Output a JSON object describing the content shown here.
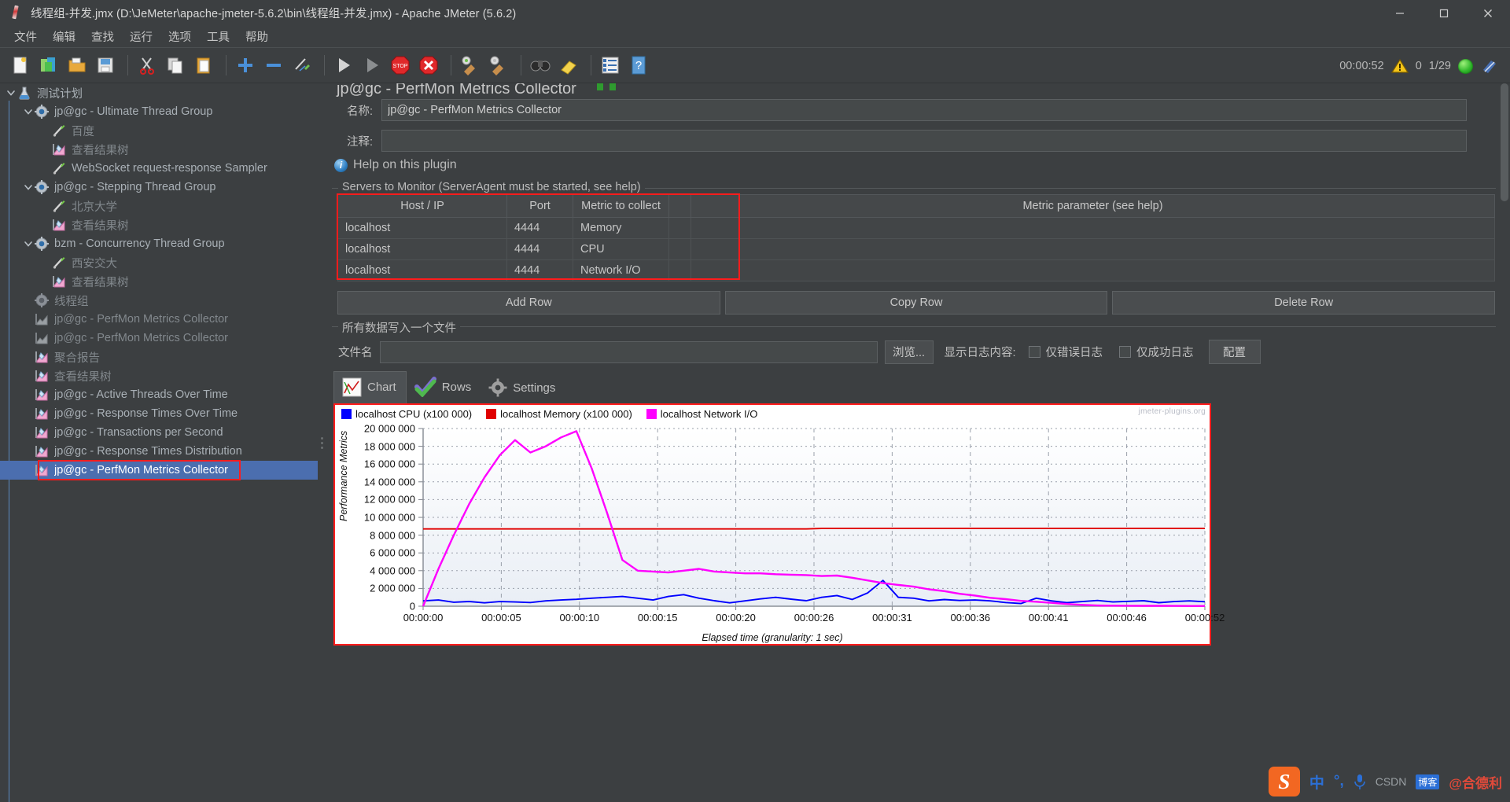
{
  "window": {
    "title": "线程组-并发.jmx (D:\\JeMeter\\apache-jmeter-5.6.2\\bin\\线程组-并发.jmx) - Apache JMeter (5.6.2)",
    "minimize_label": "Minimize",
    "maximize_label": "Maximize",
    "close_label": "Close"
  },
  "menubar": {
    "items": [
      {
        "label": "文件"
      },
      {
        "label": "编辑"
      },
      {
        "label": "查找"
      },
      {
        "label": "运行"
      },
      {
        "label": "选项"
      },
      {
        "label": "工具"
      },
      {
        "label": "帮助"
      }
    ]
  },
  "toolbar": {
    "buttons": [
      {
        "name": "new-test-plan",
        "icon": "new-document-icon"
      },
      {
        "name": "templates",
        "icon": "templates-icon"
      },
      {
        "name": "open",
        "icon": "open-folder-icon"
      },
      {
        "name": "save",
        "icon": "save-disk-icon"
      },
      {
        "name": "cut",
        "icon": "scissors-icon"
      },
      {
        "name": "copy",
        "icon": "copy-icon"
      },
      {
        "name": "paste",
        "icon": "clipboard-icon"
      },
      {
        "name": "expand-all",
        "icon": "plus-icon"
      },
      {
        "name": "collapse-all",
        "icon": "minus-icon"
      },
      {
        "name": "toggle",
        "icon": "toggle-pencil-icon"
      },
      {
        "name": "start",
        "icon": "play-icon"
      },
      {
        "name": "start-no-pauses",
        "icon": "play-no-pause-icon"
      },
      {
        "name": "stop",
        "icon": "stop-sign-icon"
      },
      {
        "name": "shutdown",
        "icon": "shutdown-icon"
      },
      {
        "name": "clear",
        "icon": "broom-green-icon"
      },
      {
        "name": "clear-all",
        "icon": "broom-icon"
      },
      {
        "name": "search",
        "icon": "binoculars-icon"
      },
      {
        "name": "reset-search",
        "icon": "eraser-icon"
      },
      {
        "name": "function-helper",
        "icon": "list-icon"
      },
      {
        "name": "help",
        "icon": "question-help-icon"
      }
    ],
    "elapsed_time": "00:00:52",
    "warning_count": "0",
    "threads_count": "1/29",
    "status_icon": "green-orb-icon",
    "jmeter_logo": "jmeter-feather-icon"
  },
  "tree": {
    "items": [
      {
        "label": "测试计划",
        "depth": 0,
        "icon": "test-plan-icon",
        "twisty": "expanded",
        "dim": false,
        "selected": false
      },
      {
        "label": "jp@gc - Ultimate Thread Group",
        "depth": 1,
        "icon": "thread-group-icon",
        "twisty": "expanded",
        "dim": false,
        "selected": false
      },
      {
        "label": "百度",
        "depth": 2,
        "icon": "sampler-icon",
        "twisty": "none",
        "dim": true,
        "selected": false
      },
      {
        "label": "查看结果树",
        "depth": 2,
        "icon": "listener-icon",
        "twisty": "none",
        "dim": true,
        "selected": false
      },
      {
        "label": "WebSocket request-response Sampler",
        "depth": 2,
        "icon": "sampler-icon",
        "twisty": "none",
        "dim": false,
        "selected": false
      },
      {
        "label": "jp@gc - Stepping Thread Group",
        "depth": 1,
        "icon": "thread-group-icon",
        "twisty": "expanded",
        "dim": false,
        "selected": false
      },
      {
        "label": "北京大学",
        "depth": 2,
        "icon": "sampler-icon",
        "twisty": "none",
        "dim": true,
        "selected": false
      },
      {
        "label": "查看结果树",
        "depth": 2,
        "icon": "listener-icon",
        "twisty": "none",
        "dim": true,
        "selected": false
      },
      {
        "label": "bzm - Concurrency Thread Group",
        "depth": 1,
        "icon": "thread-group-icon",
        "twisty": "expanded",
        "dim": false,
        "selected": false
      },
      {
        "label": "西安交大",
        "depth": 2,
        "icon": "sampler-icon",
        "twisty": "none",
        "dim": true,
        "selected": false
      },
      {
        "label": "查看结果树",
        "depth": 2,
        "icon": "listener-icon",
        "twisty": "none",
        "dim": true,
        "selected": false
      },
      {
        "label": "线程组",
        "depth": 1,
        "icon": "thread-group-disabled-icon",
        "twisty": "none",
        "dim": true,
        "selected": false
      },
      {
        "label": "jp@gc - PerfMon Metrics Collector",
        "depth": 1,
        "icon": "listener-disabled-icon",
        "twisty": "none",
        "dim": true,
        "selected": false
      },
      {
        "label": "jp@gc - PerfMon Metrics Collector",
        "depth": 1,
        "icon": "listener-disabled-icon",
        "twisty": "none",
        "dim": true,
        "selected": false
      },
      {
        "label": "聚合报告",
        "depth": 1,
        "icon": "listener-icon",
        "twisty": "none",
        "dim": true,
        "selected": false
      },
      {
        "label": "查看结果树",
        "depth": 1,
        "icon": "listener-icon",
        "twisty": "none",
        "dim": true,
        "selected": false
      },
      {
        "label": "jp@gc - Active Threads Over Time",
        "depth": 1,
        "icon": "listener-icon",
        "twisty": "none",
        "dim": false,
        "selected": false
      },
      {
        "label": "jp@gc - Response Times Over Time",
        "depth": 1,
        "icon": "listener-icon",
        "twisty": "none",
        "dim": false,
        "selected": false
      },
      {
        "label": "jp@gc - Transactions per Second",
        "depth": 1,
        "icon": "listener-icon",
        "twisty": "none",
        "dim": false,
        "selected": false
      },
      {
        "label": "jp@gc - Response Times Distribution",
        "depth": 1,
        "icon": "listener-icon",
        "twisty": "none",
        "dim": false,
        "selected": false
      },
      {
        "label": "jp@gc - PerfMon Metrics Collector",
        "depth": 1,
        "icon": "listener-icon",
        "twisty": "none",
        "dim": false,
        "selected": true
      }
    ]
  },
  "panel": {
    "title": "jp@gc - PerfMon Metrics Collector",
    "name_label": "名称:",
    "name_value": "jp@gc - PerfMon Metrics Collector",
    "comment_label": "注释:",
    "comment_value": "",
    "help_link": "Help on this plugin",
    "servers_group_title": "Servers to Monitor (ServerAgent must be started, see help)",
    "table": {
      "headers": [
        "Host / IP",
        "Port",
        "Metric to collect",
        "",
        "Metric parameter (see help)"
      ],
      "rows": [
        {
          "host": "localhost",
          "port": "4444",
          "metric": "Memory",
          "spacer": "",
          "param": ""
        },
        {
          "host": "localhost",
          "port": "4444",
          "metric": "CPU",
          "spacer": "",
          "param": ""
        },
        {
          "host": "localhost",
          "port": "4444",
          "metric": "Network I/O",
          "spacer": "",
          "param": ""
        }
      ]
    },
    "buttons": {
      "add_row": "Add Row",
      "copy_row": "Copy Row",
      "delete_row": "Delete Row"
    },
    "file_group_title": "所有数据写入一个文件",
    "filename_label": "文件名",
    "filename_value": "",
    "browse_button": "浏览...",
    "log_display_label": "显示日志内容:",
    "errors_only_label": "仅错误日志",
    "success_only_label": "仅成功日志",
    "configure_button": "配置"
  },
  "tabs": [
    {
      "label": "Chart",
      "icon": "chart-icon",
      "active": true
    },
    {
      "label": "Rows",
      "icon": "checkmark-icon",
      "active": false
    },
    {
      "label": "Settings",
      "icon": "gear-icon",
      "active": false
    }
  ],
  "colors": {
    "accent_selection": "#4b6eaf",
    "highlight_box": "#ff1c1c",
    "link": "#3f7fe0",
    "cpu_series": "#0000ff",
    "memory_series": "#e00000",
    "network_series": "#ff00ff"
  },
  "ime": {
    "logo": "S",
    "mode": "中",
    "punct": "°,",
    "mic": "mic-icon",
    "label_csdn": "CSDN",
    "label_badge": "博客",
    "label_user": "@合德利"
  },
  "chart_data": {
    "type": "line",
    "title": "",
    "watermark": "jmeter-plugins.org",
    "xlabel": "Elapsed time (granularity: 1 sec)",
    "ylabel": "Performance Metrics",
    "ylim": [
      0,
      20000000
    ],
    "yticks": [
      "0",
      "2 000 000",
      "4 000 000",
      "6 000 000",
      "8 000 000",
      "10 000 000",
      "12 000 000",
      "14 000 000",
      "16 000 000",
      "18 000 000",
      "20 000 000"
    ],
    "xticks": [
      "00:00:00",
      "00:00:05",
      "00:00:10",
      "00:00:15",
      "00:00:20",
      "00:00:26",
      "00:00:31",
      "00:00:36",
      "00:00:41",
      "00:00:46",
      "00:00:52"
    ],
    "grid": true,
    "legend_position": "top-left",
    "legend": [
      "localhost CPU (x100 000)",
      "localhost Memory (x100 000)",
      "localhost Network I/O"
    ],
    "series": [
      {
        "name": "localhost CPU (x100 000)",
        "color": "#0000ff",
        "values": [
          600000,
          700000,
          450000,
          530000,
          380000,
          520000,
          480000,
          420000,
          600000,
          700000,
          780000,
          900000,
          1000000,
          1100000,
          900000,
          700000,
          1100000,
          1300000,
          900000,
          620000,
          380000,
          600000,
          820000,
          1000000,
          800000,
          620000,
          1000000,
          1200000,
          760000,
          1500000,
          2900000,
          1000000,
          900000,
          600000,
          750000,
          650000,
          700000,
          600000,
          420000,
          300000,
          900000,
          600000,
          400000,
          520000,
          650000,
          480000,
          550000,
          620000,
          400000,
          520000,
          600000,
          500000
        ]
      },
      {
        "name": "localhost Memory (x100 000)",
        "color": "#e00000",
        "values": [
          8700000,
          8700000,
          8700000,
          8700000,
          8700000,
          8700000,
          8700000,
          8700000,
          8700000,
          8700000,
          8700000,
          8700000,
          8700000,
          8700000,
          8700000,
          8700000,
          8700000,
          8700000,
          8700000,
          8700000,
          8700000,
          8700000,
          8700000,
          8700000,
          8700000,
          8700000,
          8750000,
          8750000,
          8750000,
          8750000,
          8750000,
          8750000,
          8750000,
          8750000,
          8750000,
          8750000,
          8750000,
          8750000,
          8750000,
          8750000,
          8750000,
          8750000,
          8750000,
          8750000,
          8750000,
          8750000,
          8750000,
          8750000,
          8750000,
          8750000,
          8750000,
          8750000
        ]
      },
      {
        "name": "localhost Network I/O",
        "color": "#ff00ff",
        "values": [
          0,
          4200000,
          8000000,
          11500000,
          14500000,
          17000000,
          18700000,
          17300000,
          18000000,
          19000000,
          19700000,
          15500000,
          10500000,
          5200000,
          4000000,
          3900000,
          3800000,
          4000000,
          4200000,
          3900000,
          3800000,
          3700000,
          3700000,
          3600000,
          3550000,
          3500000,
          3400000,
          3450000,
          3200000,
          2900000,
          2600000,
          2400000,
          2200000,
          1900000,
          1700000,
          1400000,
          1200000,
          950000,
          800000,
          600000,
          500000,
          380000,
          250000,
          150000,
          80000,
          60000,
          50000,
          45000,
          40000,
          35000,
          30000,
          25000
        ]
      }
    ]
  }
}
